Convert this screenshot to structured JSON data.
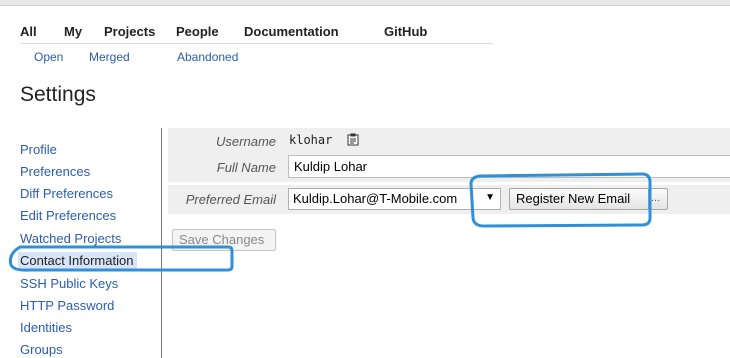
{
  "top_nav": {
    "items": [
      "All",
      "My",
      "Projects",
      "People",
      "Documentation",
      "GitHub"
    ]
  },
  "sub_nav": {
    "items": [
      "Open",
      "Merged",
      "Abandoned"
    ]
  },
  "page": {
    "title": "Settings"
  },
  "sidebar": {
    "items": [
      "Profile",
      "Preferences",
      "Diff Preferences",
      "Edit Preferences",
      "Watched Projects",
      "Contact Information",
      "SSH Public Keys",
      "HTTP Password",
      "Identities",
      "Groups"
    ],
    "selected": "Contact Information"
  },
  "form": {
    "username_label": "Username",
    "username_value": "klohar",
    "fullname_label": "Full Name",
    "fullname_value": "Kuldip Lohar",
    "email_label": "Preferred Email",
    "email_value": "Kuldip.Lohar@T-Mobile.com",
    "email_dropdown_arrow": "▼",
    "register_button": "Register New Email",
    "register_more": "...",
    "save_button": "Save Changes"
  },
  "icons": {
    "copy": "clipboard-icon"
  },
  "colors": {
    "link": "#2a5db0",
    "annotation": "#2f8fd8",
    "field_background": "#efefef",
    "selected_background": "#d8e4f8"
  }
}
